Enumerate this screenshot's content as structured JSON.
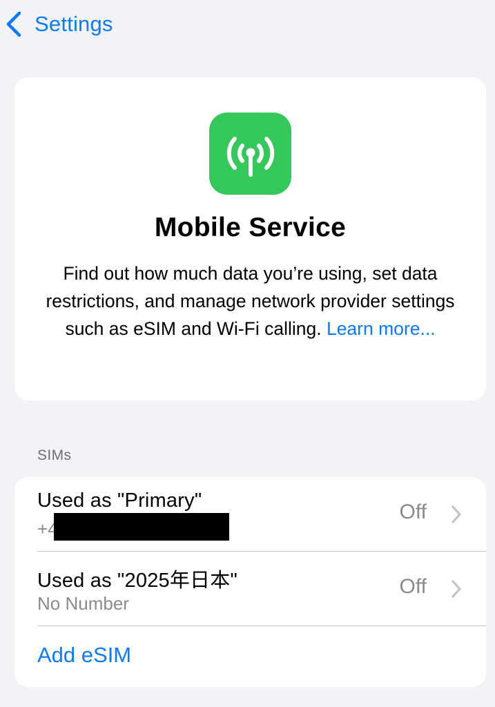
{
  "nav": {
    "back_label": "Settings"
  },
  "info": {
    "icon": "antenna-signal-icon",
    "icon_color": "#34c759",
    "title": "Mobile Service",
    "description": "Find out how much data you’re using, set data restrictions, and manage network provider settings such as eSIM and Wi-Fi calling.",
    "learn_more": "Learn more..."
  },
  "sims": {
    "header": "SIMs",
    "items": [
      {
        "title": "Used as \"Primary\"",
        "subtitle": "+4",
        "value": "Off"
      },
      {
        "title": "Used as \"2025年日本\"",
        "subtitle": "No Number",
        "value": "Off"
      }
    ],
    "add_label": "Add eSIM"
  },
  "colors": {
    "accent": "#0a7aff",
    "background": "#f2f2f7",
    "secondary_text": "#8a8a8e"
  }
}
